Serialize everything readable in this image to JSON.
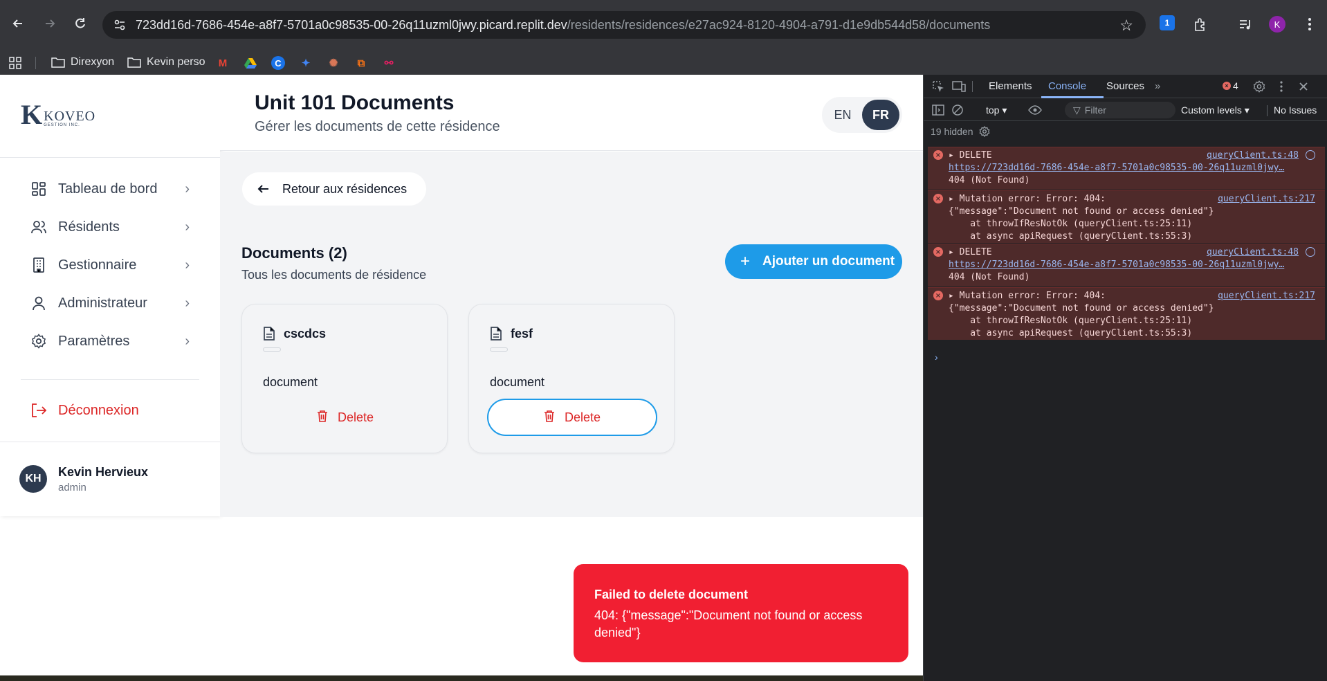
{
  "browser": {
    "url_host": "723dd16d-7686-454e-a8f7-5701a0c98535-00-26q11uzml0jwy.picard.replit.dev",
    "url_path": "/residents/residences/e27ac924-8120-4904-a791-d1e9db544d58/documents",
    "profile_initial": "K",
    "bookmarks": [
      "Direxyon",
      "Kevin perso"
    ]
  },
  "app": {
    "logo_name": "KOVEO",
    "logo_sub": "GESTION INC.",
    "nav": [
      {
        "label": "Tableau de bord",
        "icon": "dashboard-icon"
      },
      {
        "label": "Résidents",
        "icon": "users-icon"
      },
      {
        "label": "Gestionnaire",
        "icon": "building-icon"
      },
      {
        "label": "Administrateur",
        "icon": "user-icon"
      },
      {
        "label": "Paramètres",
        "icon": "gear-icon"
      }
    ],
    "logout_label": "Déconnexion",
    "user": {
      "initials": "KH",
      "name": "Kevin Hervieux",
      "role": "admin"
    },
    "header": {
      "title": "Unit 101 Documents",
      "subtitle": "Gérer les documents de cette résidence"
    },
    "lang": {
      "en": "EN",
      "fr": "FR",
      "selected": "FR"
    },
    "back_label": "Retour aux résidences",
    "documents": {
      "title": "Documents (2)",
      "subtitle": "Tous les documents de résidence",
      "add_label": "Ajouter un document",
      "items": [
        {
          "name": "cscdcs",
          "type": "document",
          "delete_label": "Delete"
        },
        {
          "name": "fesf",
          "type": "document",
          "delete_label": "Delete"
        }
      ]
    },
    "toast": {
      "title": "Failed to delete document",
      "message": "404: {\"message\":\"Document not found or access denied\"}"
    }
  },
  "devtools": {
    "tabs": [
      "Elements",
      "Console",
      "Sources"
    ],
    "active_tab": "Console",
    "error_count": "4",
    "context": "top",
    "filter_placeholder": "Filter",
    "levels": "Custom levels",
    "issues": "No Issues",
    "hidden": "19 hidden",
    "logs": [
      {
        "lines": [
          "DELETE",
          "https://723dd16d-7686-454e-a8f7-5701a0c98535-00-26q11uzml0jwy…",
          "404 (Not Found)"
        ],
        "src": "queryClient.ts:48"
      },
      {
        "lines": [
          "Mutation error: Error: 404:",
          "{\"message\":\"Document not found or access denied\"}",
          "    at throwIfResNotOk (queryClient.ts:25:11)",
          "    at async apiRequest (queryClient.ts:55:3)"
        ],
        "src": "queryClient.ts:217"
      },
      {
        "lines": [
          "DELETE",
          "https://723dd16d-7686-454e-a8f7-5701a0c98535-00-26q11uzml0jwy…",
          "404 (Not Found)"
        ],
        "src": "queryClient.ts:48"
      },
      {
        "lines": [
          "Mutation error: Error: 404:",
          "{\"message\":\"Document not found or access denied\"}",
          "    at throwIfResNotOk (queryClient.ts:25:11)",
          "    at async apiRequest (queryClient.ts:55:3)"
        ],
        "src": "queryClient.ts:217"
      }
    ]
  }
}
